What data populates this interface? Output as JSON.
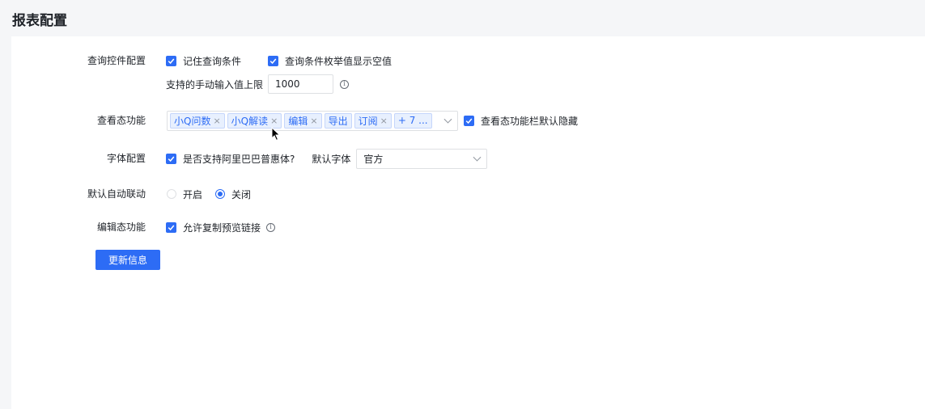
{
  "page": {
    "title": "报表配置"
  },
  "query_control": {
    "label": "查询控件配置",
    "remember_label": "记住查询条件",
    "remember_checked": true,
    "empty_value_label": "查询条件枚举值显示空值",
    "empty_value_checked": true,
    "manual_limit_label": "支持的手动输入值上限",
    "manual_limit_value": "1000"
  },
  "view_features": {
    "label": "查看态功能",
    "tags": [
      "小Q问数",
      "小Q解读",
      "编辑",
      "导出",
      "订阅"
    ],
    "closable": [
      true,
      true,
      true,
      false,
      true
    ],
    "more_label": "+ 7 ...",
    "hide_default_label": "查看态功能栏默认隐藏",
    "hide_default_checked": true
  },
  "font_config": {
    "label": "字体配置",
    "alibaba_label": "是否支持阿里巴巴普惠体?",
    "alibaba_checked": true,
    "default_font_label": "默认字体",
    "default_font_value": "官方"
  },
  "auto_link": {
    "label": "默认自动联动",
    "options": [
      "开启",
      "关闭"
    ],
    "selected": "关闭"
  },
  "edit_features": {
    "label": "编辑态功能",
    "copy_link_label": "允许复制预览链接",
    "copy_link_checked": true
  },
  "update_button_label": "更新信息",
  "colors": {
    "primary": "#2d6cf5",
    "tag_bg": "#e8f0fe",
    "page_bg": "#f5f6f8"
  }
}
